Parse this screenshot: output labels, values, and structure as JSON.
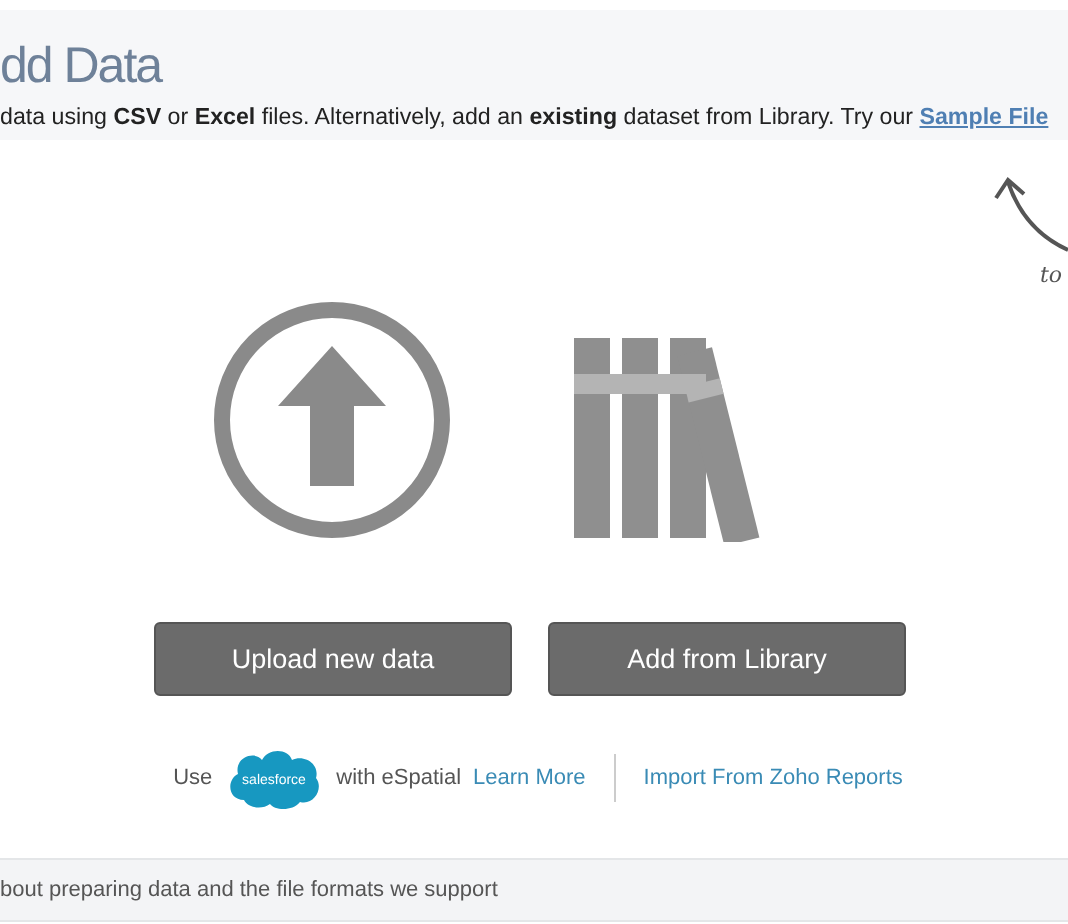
{
  "header": {
    "title": "dd Data",
    "description": "data using **CSV** or **Excel** files. Alternatively, add an **existing** dataset from Library. Try our",
    "link": "Sample File"
  },
  "annotation": {
    "text": "to"
  },
  "buttons": [
    {
      "label": "Upload new data",
      "kind": "upload"
    },
    {
      "label": "Add from Library",
      "kind": "library"
    }
  ],
  "integrations": {
    "prefix": "Use",
    "logo": "salesforce",
    "suffix": "with eSpatial",
    "learn_more": "Learn More",
    "import_link": "Import From Zoho Reports"
  },
  "footer": {
    "text": "bout preparing data and the file formats we support"
  }
}
